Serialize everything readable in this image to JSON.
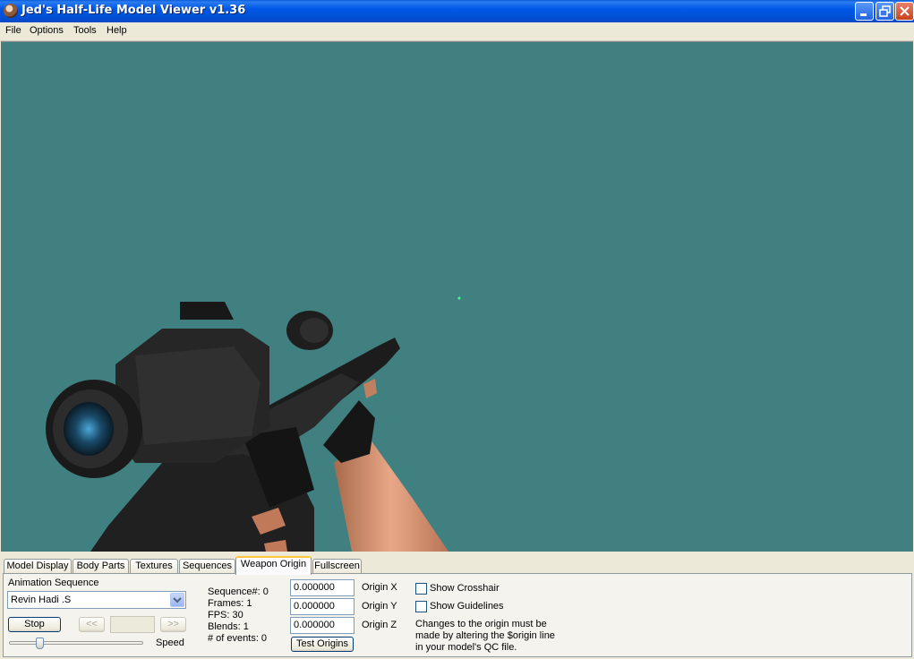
{
  "window": {
    "title": "Jed's Half-Life Model Viewer v1.36"
  },
  "menu": {
    "file": "File",
    "options": "Options",
    "tools": "Tools",
    "help": "Help"
  },
  "tabs": [
    {
      "label": "Model Display",
      "active": false
    },
    {
      "label": "Body Parts",
      "active": false
    },
    {
      "label": "Textures",
      "active": false
    },
    {
      "label": "Sequences",
      "active": false
    },
    {
      "label": "Weapon Origin",
      "active": true
    },
    {
      "label": "Fullscreen",
      "active": false
    }
  ],
  "animation": {
    "label": "Animation Sequence",
    "selected": "Revin Hadi .S",
    "stop_label": "Stop",
    "prev_label": "<<",
    "next_label": ">>",
    "frame_value": "",
    "speed_label": "Speed",
    "speed_fraction": 0.2
  },
  "sequence_info": {
    "sequence": "Sequence#: 0",
    "frames": "Frames: 1",
    "fps": "FPS: 30",
    "blends": "Blends: 1",
    "events": "# of events: 0"
  },
  "origin": {
    "x_value": "0.000000",
    "x_label": "Origin X",
    "y_value": "0.000000",
    "y_label": "Origin Y",
    "z_value": "0.000000",
    "z_label": "Origin Z",
    "test_label": "Test Origins"
  },
  "options": {
    "crosshair_label": "Show Crosshair",
    "crosshair_checked": false,
    "guidelines_label": "Show Guidelines",
    "guidelines_checked": false,
    "note_line1": "Changes to the origin must be",
    "note_line2": "made by altering the $origin line",
    "note_line3": "in your model's QC file."
  },
  "colors": {
    "viewport_bg": "#408080",
    "titlebar": "#0058e6"
  }
}
